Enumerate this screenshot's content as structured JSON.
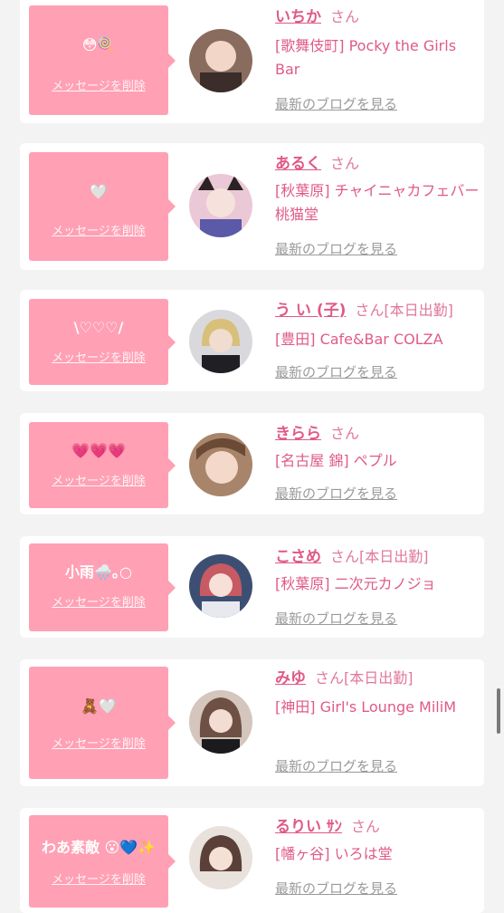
{
  "delete_label": "メッセージを削除",
  "blog_label": "最新のブログを見る",
  "san_label": "さん",
  "colors": {
    "accent": "#e05a86",
    "bubble": "#ffa0b4",
    "background": "#f3f3f3"
  },
  "entries": [
    {
      "message": "😳🍭",
      "name": "いちか",
      "suffix": "さん",
      "shop": "[歌舞伎町] Pocky the Girls Bar",
      "avatar_icon": "avatar-icon"
    },
    {
      "message": "🤍",
      "name": "あるく",
      "suffix": "さん",
      "shop": "[秋葉原] チャイニャカフェバー 桃猫堂",
      "avatar_icon": "avatar-icon"
    },
    {
      "message": "\\♡♡♡/",
      "name": "う い (子)",
      "suffix": "さん[本日出勤]",
      "shop": "[豊田] Cafe&Bar COLZA",
      "avatar_icon": "avatar-icon"
    },
    {
      "message": "💗💗💗",
      "name": "きらら",
      "suffix": "さん",
      "shop": "[名古屋 錦] ペプル",
      "avatar_icon": "avatar-icon"
    },
    {
      "message": "小雨🌧️｡○",
      "name": "こさめ",
      "suffix": "さん[本日出勤]",
      "shop": "[秋葉原] 二次元カノジョ",
      "avatar_icon": "avatar-icon"
    },
    {
      "message": "🧸🤍",
      "name": "みゆ",
      "suffix": "さん[本日出勤]",
      "shop": "[神田] Girl's Lounge MiliM",
      "avatar_icon": "avatar-icon"
    },
    {
      "message": "わあ素敵 😮💙✨",
      "name": "るりい ｻﾝ",
      "suffix": "さん",
      "shop": "[幡ヶ谷] いろは堂",
      "avatar_icon": "avatar-icon"
    }
  ]
}
